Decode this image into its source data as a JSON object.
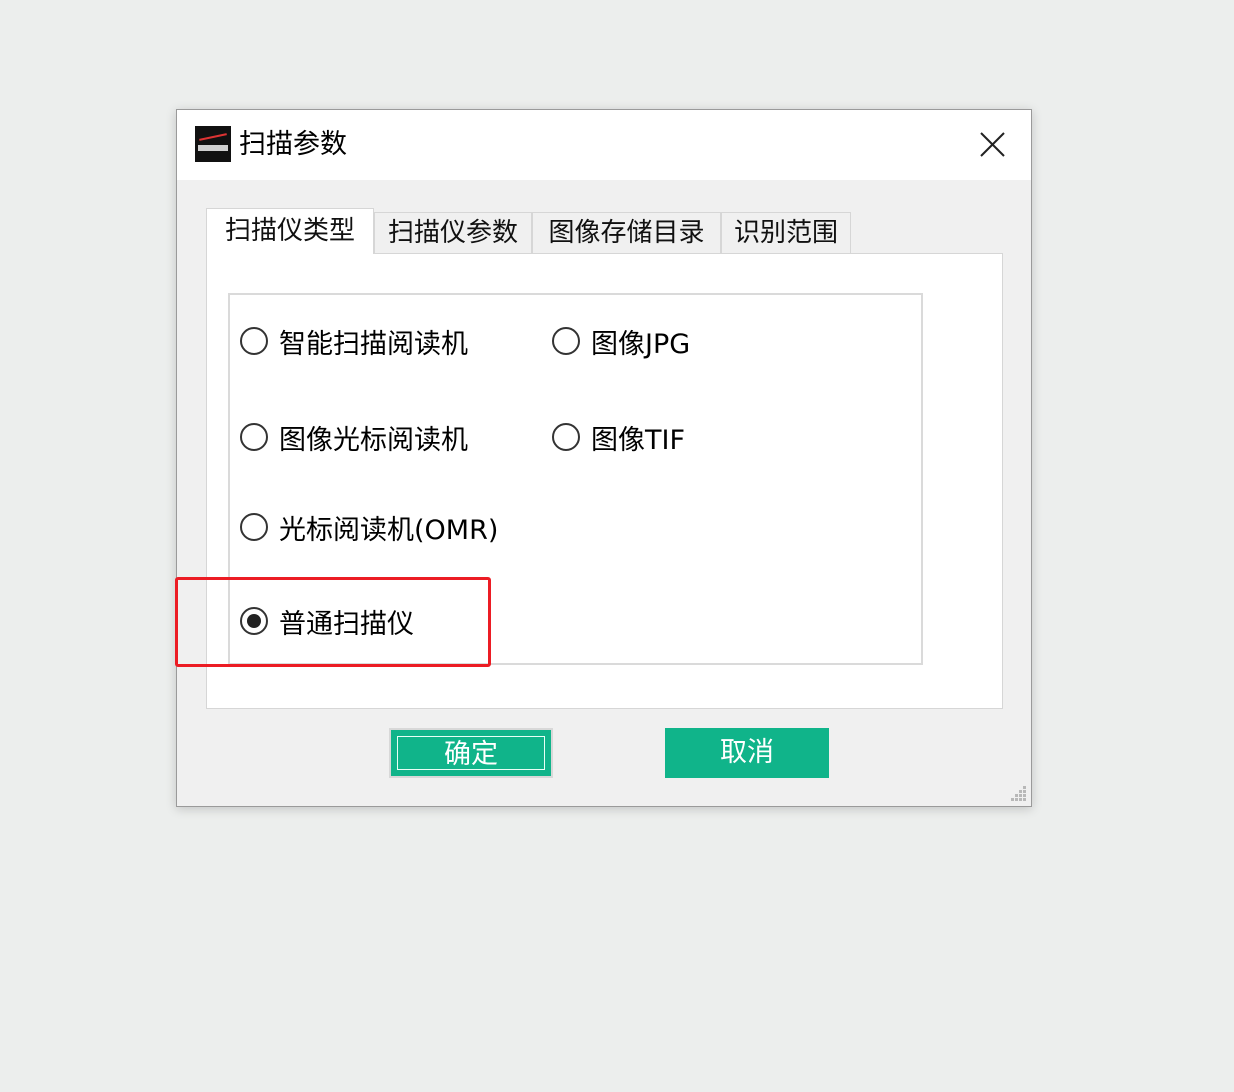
{
  "window": {
    "title": "扫描参数"
  },
  "tabs": [
    {
      "label": "扫描仪类型",
      "active": true
    },
    {
      "label": "扫描仪参数",
      "active": false
    },
    {
      "label": "图像存储目录",
      "active": false
    },
    {
      "label": "识别范围",
      "active": false
    }
  ],
  "scanner_types": [
    {
      "label": "智能扫描阅读机",
      "checked": false
    },
    {
      "label": "图像JPG",
      "checked": false
    },
    {
      "label": "图像光标阅读机",
      "checked": false
    },
    {
      "label": "图像TIF",
      "checked": false
    },
    {
      "label": "光标阅读机(OMR)",
      "checked": false
    },
    {
      "label": "普通扫描仪",
      "checked": true
    }
  ],
  "buttons": {
    "ok_label": "确定",
    "cancel_label": "取消"
  },
  "colors": {
    "button_bg": "#10b48a",
    "highlight": "#ec1c24"
  },
  "icons": {
    "app": "app-logo-icon",
    "close": "close-icon",
    "grip": "resize-grip-icon"
  }
}
